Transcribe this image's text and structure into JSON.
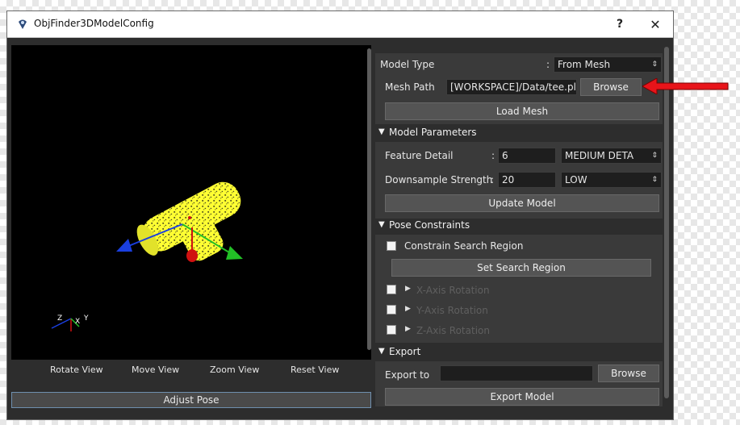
{
  "window": {
    "title": "ObjFinder3DModelConfig",
    "help_label": "?",
    "close_label": "✕"
  },
  "viewport": {
    "axis_labels": {
      "z": "Z",
      "x": "X",
      "y": "Y"
    },
    "view_buttons": [
      "Rotate View",
      "Move View",
      "Zoom View",
      "Reset View"
    ],
    "adjust_label": "Adjust Pose"
  },
  "panel": {
    "model_type_label": "Model Type",
    "model_type_colon": ":",
    "model_type_value": "From Mesh",
    "mesh_path_label": "Mesh Path",
    "mesh_path_value": "[WORKSPACE]/Data/tee.ply",
    "browse_label": "Browse",
    "load_mesh_label": "Load Mesh",
    "model_params": {
      "title": "Model Parameters",
      "feature_detail_label": "Feature Detail",
      "feature_detail_colon": ":",
      "feature_detail_value": "6",
      "feature_detail_level": "MEDIUM DETA",
      "downsample_label": "Downsample Strength",
      "downsample_colon": ":",
      "downsample_value": "20",
      "downsample_level": "LOW",
      "update_label": "Update Model"
    },
    "pose": {
      "title": "Pose Constraints",
      "constrain_label": "Constrain Search Region",
      "set_region_label": "Set Search Region",
      "x_rot": "X-Axis Rotation",
      "y_rot": "Y-Axis Rotation",
      "z_rot": "Z-Axis Rotation"
    },
    "export": {
      "title": "Export",
      "export_to_label": "Export to",
      "export_to_value": "",
      "browse_label": "Browse",
      "export_model_label": "Export Model"
    }
  },
  "colors": {
    "accent_arrow": "#e8141a",
    "point_cloud": "#ffff33"
  }
}
